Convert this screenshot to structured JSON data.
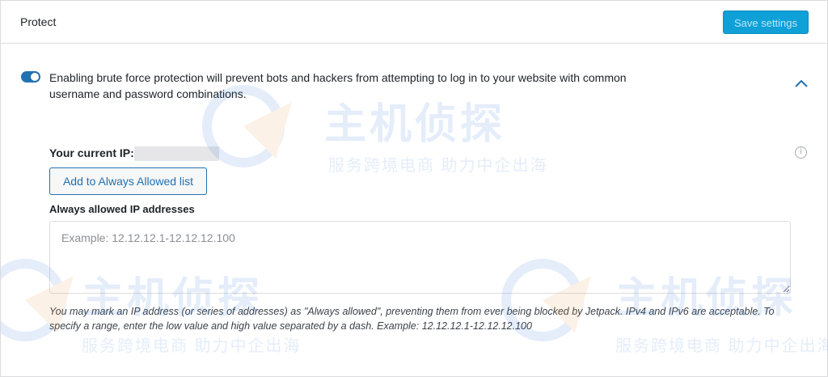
{
  "header": {
    "title": "Protect",
    "save_label": "Save settings"
  },
  "protection": {
    "toggle_on": true,
    "description": "Enabling brute force protection will prevent bots and hackers from attempting to log in to your website with common username and password combinations."
  },
  "current_ip": {
    "label": "Your current IP:",
    "add_button_label": "Add to Always Allowed list"
  },
  "allowed_ips": {
    "label": "Always allowed IP addresses",
    "placeholder": "Example: 12.12.12.1-12.12.12.100",
    "value": "",
    "help_text": "You may mark an IP address (or series of addresses) as \"Always allowed\", preventing them from ever being blocked by Jetpack. IPv4 and IPv6 are acceptable. To specify a range, enter the low value and high value separated by a dash. Example: 12.12.12.1-12.12.12.100"
  },
  "watermark": {
    "title": "主机侦探",
    "subtitle": "服务跨境电商  助力中企出海"
  },
  "icons": {
    "chevron": "chevron-up-icon",
    "info": "info-icon",
    "toggle": "toggle-switch"
  },
  "colors": {
    "accent": "#2271b1",
    "save_button_bg": "#0fa0d8",
    "watermark": "#2a6fd6"
  }
}
